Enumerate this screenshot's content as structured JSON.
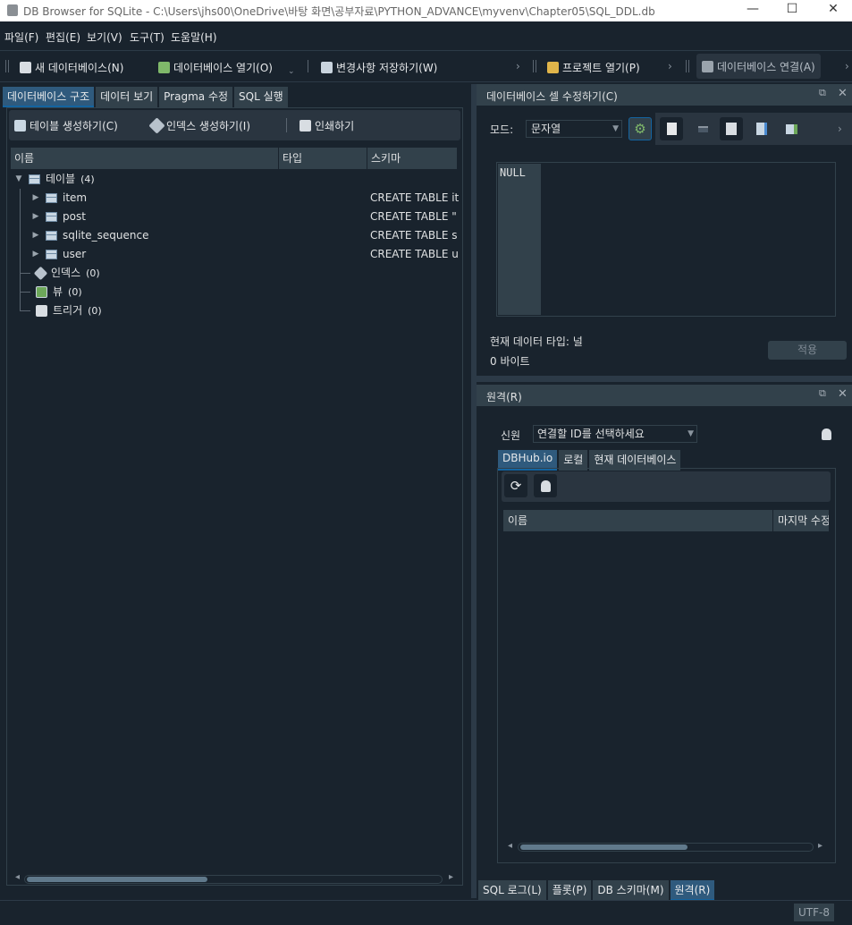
{
  "window": {
    "title": "DB Browser for SQLite - C:\\Users\\jhs00\\OneDrive\\바탕 화면\\공부자료\\PYTHON_ADVANCE\\myvenv\\Chapter05\\SQL_DDL.db",
    "minimize": "—",
    "maximize": "☐",
    "close": "✕"
  },
  "menu": [
    "파일(F)",
    "편집(E)",
    "보기(V)",
    "도구(T)",
    "도움말(H)"
  ],
  "toolbar": {
    "new_db": "새 데이터베이스(N)",
    "open_db": "데이터베이스 열기(O)",
    "write_changes": "변경사항 저장하기(W)",
    "open_project": "프로젝트 열기(P)",
    "attach_db": "데이터베이스 연결(A)"
  },
  "left": {
    "tabs": [
      "데이터베이스 구조",
      "데이터 보기",
      "Pragma 수정",
      "SQL 실행"
    ],
    "tools": {
      "create_table": "테이블 생성하기(C)",
      "create_index": "인덱스 생성하기(I)",
      "print": "인쇄하기"
    },
    "columns": [
      "이름",
      "타입",
      "스키마"
    ],
    "tree": {
      "tables_label": "테이블",
      "tables_count": "(4)",
      "tables": [
        {
          "name": "item",
          "schema": "CREATE TABLE it"
        },
        {
          "name": "post",
          "schema": "CREATE TABLE \""
        },
        {
          "name": "sqlite_sequence",
          "schema": "CREATE TABLE s"
        },
        {
          "name": "user",
          "schema": "CREATE TABLE u"
        }
      ],
      "indexes_label": "인덱스",
      "indexes_count": "(0)",
      "views_label": "뷰",
      "views_count": "(0)",
      "triggers_label": "트리거",
      "triggers_count": "(0)"
    }
  },
  "cell_editor": {
    "title": "데이터베이스 셀 수정하기(C)",
    "mode_label": "모드:",
    "mode_value": "문자열",
    "cell_value": "NULL",
    "data_type": "현재 데이터 타입: 널",
    "size": "0 바이트",
    "apply": "적용"
  },
  "remote": {
    "title": "원격(R)",
    "source_label": "신원",
    "source_value": "연결할 ID를 선택하세요",
    "tabs": [
      "DBHub.io",
      "로컬",
      "현재 데이터베이스"
    ],
    "columns": [
      "이름",
      "마지막 수정"
    ]
  },
  "bottom_tabs": [
    "SQL 로그(L)",
    "플롯(P)",
    "DB 스키마(M)",
    "원격(R)"
  ],
  "status": {
    "encoding": "UTF-8"
  },
  "colors": {
    "background": "#19232d",
    "panel": "#32414b",
    "active_tab": "#1464a0"
  }
}
